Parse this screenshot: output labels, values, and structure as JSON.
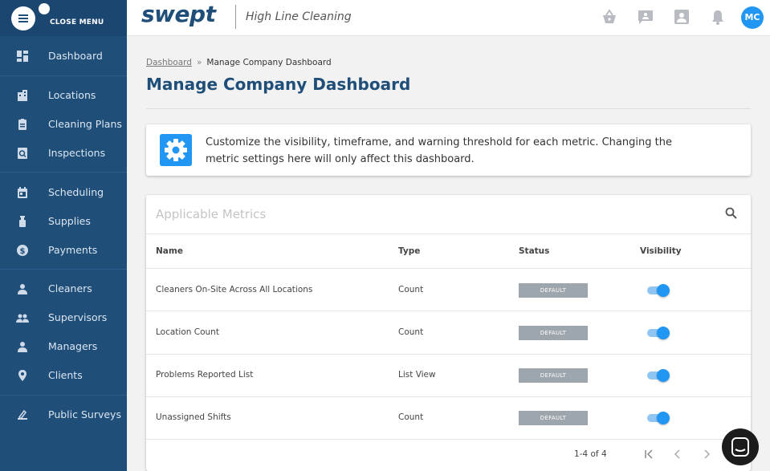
{
  "sidebar": {
    "close_label": "CLOSE MENU",
    "items": [
      {
        "label": "Dashboard",
        "icon": "dashboard-icon"
      },
      {
        "label": "Locations",
        "icon": "building-icon"
      },
      {
        "label": "Cleaning Plans",
        "icon": "clipboard-icon"
      },
      {
        "label": "Inspections",
        "icon": "inspection-icon"
      },
      {
        "label": "Scheduling",
        "icon": "calendar-icon"
      },
      {
        "label": "Supplies",
        "icon": "spray-bottle-icon"
      },
      {
        "label": "Payments",
        "icon": "dollar-icon"
      },
      {
        "label": "Cleaners",
        "icon": "person-icon"
      },
      {
        "label": "Supervisors",
        "icon": "group-icon"
      },
      {
        "label": "Managers",
        "icon": "person-icon"
      },
      {
        "label": "Clients",
        "icon": "location-pin-icon"
      },
      {
        "label": "Public Surveys",
        "icon": "survey-icon"
      }
    ]
  },
  "header": {
    "logo": "swept",
    "company": "High Line Cleaning",
    "avatar_initials": "MC",
    "icons": [
      "basket-icon",
      "message-icon",
      "contact-icon",
      "bell-icon"
    ]
  },
  "breadcrumb": {
    "parent": "Dashboard",
    "separator": "»",
    "current": "Manage Company Dashboard"
  },
  "page_title": "Manage Company Dashboard",
  "info": {
    "text": "Customize the visibility, timeframe, and warning threshold for each metric. Changing the metric settings here will only affect this dashboard."
  },
  "metrics": {
    "title": "Applicable Metrics",
    "columns": [
      "Name",
      "Type",
      "Status",
      "Visibility"
    ],
    "rows": [
      {
        "name": "Cleaners On-Site Across All Locations",
        "type": "Count",
        "status": "DEFAULT",
        "visible": true
      },
      {
        "name": "Location Count",
        "type": "Count",
        "status": "DEFAULT",
        "visible": true
      },
      {
        "name": "Problems Reported List",
        "type": "List View",
        "status": "DEFAULT",
        "visible": true
      },
      {
        "name": "Unassigned Shifts",
        "type": "Count",
        "status": "DEFAULT",
        "visible": true
      }
    ],
    "pagination": "1-4 of 4"
  },
  "colors": {
    "sidebar": "#1f4e79",
    "accent": "#2196f3",
    "badge": "#9ea6ad"
  }
}
